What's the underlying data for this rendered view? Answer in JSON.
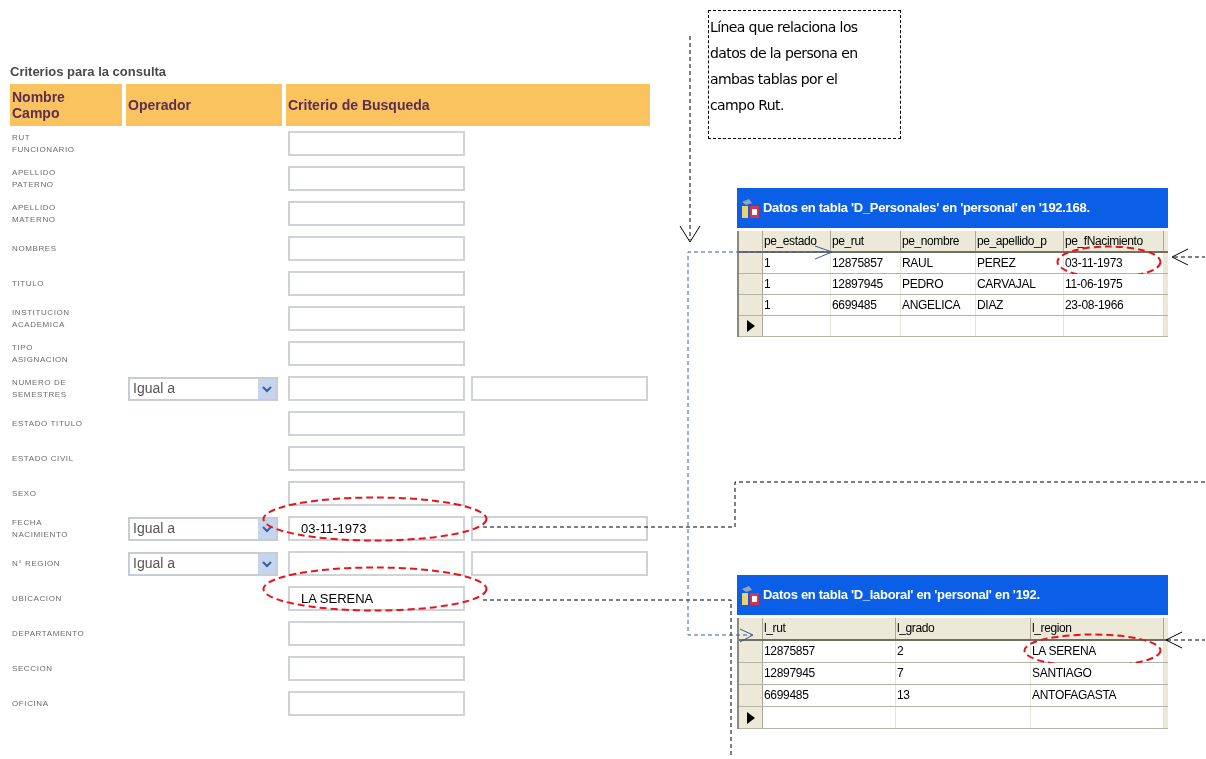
{
  "note": {
    "text": "Línea que relaciona los datos de la persona en ambas tablas por el campo Rut."
  },
  "form": {
    "title": "Criterios para la consulta",
    "columns": [
      "Nombre Campo",
      "Operador",
      "Criterio de Busqueda"
    ],
    "rows": [
      {
        "label": "RUT FUNCIONARIO",
        "highlighted": false
      },
      {
        "label": "APELLIDO PATERNO",
        "highlighted": false
      },
      {
        "label": "APELLIDO MATERNO",
        "highlighted": false
      },
      {
        "label": "NOMBRES",
        "highlighted": false
      },
      {
        "label": "TITULO",
        "highlighted": false
      },
      {
        "label": "INSTITUCION ACADEMICA",
        "highlighted": false
      },
      {
        "label": "TIPO ASIGNACION",
        "highlighted": false
      },
      {
        "label": "NUMERO DE SEMESTRES",
        "operator": "Igual a",
        "highlighted": false
      },
      {
        "label": "ESTADO TITULO",
        "highlighted": false
      },
      {
        "label": "ESTADO CIVIL",
        "highlighted": false
      },
      {
        "label": "SEXO",
        "highlighted": false
      },
      {
        "label": "FECHA NACIMIENTO",
        "operator": "Igual a",
        "value": "03-11-1973",
        "highlighted": true
      },
      {
        "label": "N° REGION",
        "operator": "Igual a",
        "highlighted": false
      },
      {
        "label": "UBICACION",
        "value": "LA SERENA",
        "highlighted": true
      },
      {
        "label": "DEPARTAMENTO",
        "highlighted": false
      },
      {
        "label": "SECCION",
        "highlighted": false
      },
      {
        "label": "OFICINA",
        "highlighted": false
      }
    ]
  },
  "tables": [
    {
      "title": "Datos en tabla 'D_Personales' en 'personal' en '192.168.",
      "columns": [
        "pe_estado",
        "pe_rut",
        "pe_nombre",
        "pe_apellido_p",
        "pe_fNacimiento"
      ],
      "rows": [
        [
          {
            "text": "1",
            "circled": false
          },
          {
            "text": "12875857",
            "circled": false
          },
          {
            "text": "RAUL",
            "circled": false
          },
          {
            "text": "PEREZ",
            "circled": false
          },
          {
            "text": "03-11-1973",
            "circled": true
          }
        ],
        [
          {
            "text": "1",
            "circled": false
          },
          {
            "text": "12897945",
            "circled": false
          },
          {
            "text": "PEDRO",
            "circled": false
          },
          {
            "text": "CARVAJAL",
            "circled": false
          },
          {
            "text": "11-06-1975",
            "circled": false
          }
        ],
        [
          {
            "text": "1",
            "circled": false
          },
          {
            "text": "6699485",
            "circled": false
          },
          {
            "text": "ANGELICA",
            "circled": false
          },
          {
            "text": "DIAZ",
            "circled": false
          },
          {
            "text": "23-08-1966",
            "circled": false
          }
        ]
      ]
    },
    {
      "title": "Datos en tabla 'D_laboral' en 'personal' en '192.",
      "columns": [
        "l_rut",
        "l_grado",
        "l_region"
      ],
      "rows": [
        [
          {
            "text": "12875857",
            "circled": false
          },
          {
            "text": "2",
            "circled": false
          },
          {
            "text": "LA SERENA",
            "circled": true
          }
        ],
        [
          {
            "text": "12897945",
            "circled": false
          },
          {
            "text": "7",
            "circled": false
          },
          {
            "text": "SANTIAGO",
            "circled": false
          }
        ],
        [
          {
            "text": "6699485",
            "circled": false
          },
          {
            "text": "13",
            "circled": false
          },
          {
            "text": "ANTOFAGASTA",
            "circled": false
          }
        ]
      ]
    }
  ]
}
